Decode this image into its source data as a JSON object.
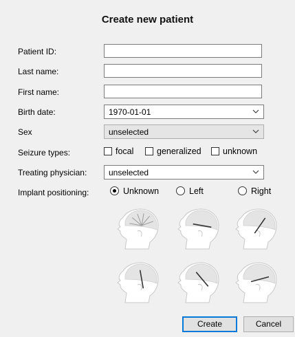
{
  "dialog": {
    "title": "Create new patient"
  },
  "fields": {
    "patient_id": {
      "label": "Patient ID:",
      "value": ""
    },
    "last_name": {
      "label": "Last name:",
      "value": ""
    },
    "first_name": {
      "label": "First name:",
      "value": ""
    },
    "birth_date": {
      "label": "Birth date:",
      "value": "1970-01-01"
    },
    "sex": {
      "label": "Sex",
      "value": "unselected"
    },
    "seizure_types": {
      "label": "Seizure types:",
      "options": [
        {
          "label": "focal",
          "checked": false
        },
        {
          "label": "generalized",
          "checked": false
        },
        {
          "label": "unknown",
          "checked": false
        }
      ]
    },
    "treating_physician": {
      "label": "Treating physician:",
      "value": "unselected"
    },
    "implant_positioning": {
      "label": "Implant positioning:",
      "options": [
        {
          "label": "Unknown",
          "selected": true
        },
        {
          "label": "Left",
          "selected": false
        },
        {
          "label": "Right",
          "selected": false
        }
      ]
    }
  },
  "implant_images": [
    {
      "icon": "head-implant-icon",
      "angle": 0,
      "style": "fan"
    },
    {
      "icon": "head-implant-icon",
      "angle": 100,
      "style": "line"
    },
    {
      "icon": "head-implant-icon",
      "angle": 35,
      "style": "line"
    },
    {
      "icon": "head-implant-icon",
      "angle": 170,
      "style": "line"
    },
    {
      "icon": "head-implant-icon",
      "angle": 140,
      "style": "line"
    },
    {
      "icon": "head-implant-icon",
      "angle": 75,
      "style": "line"
    }
  ],
  "buttons": {
    "create": "Create",
    "cancel": "Cancel"
  },
  "colors": {
    "background": "#f0f0f0",
    "accent": "#0078d7"
  }
}
